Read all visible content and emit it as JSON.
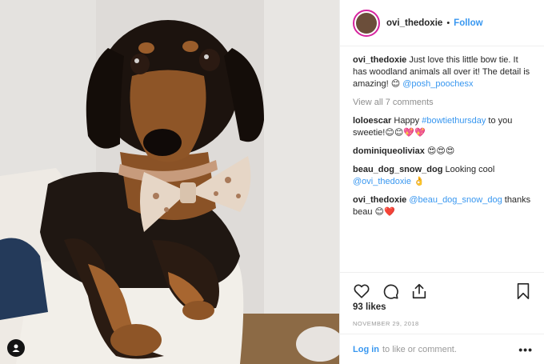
{
  "header": {
    "username": "ovi_thedoxie",
    "separator": "•",
    "follow_label": "Follow"
  },
  "caption": {
    "username": "ovi_thedoxie",
    "text": "Just love this little bow tie. It has woodland animals all over it! The detail is amazing!",
    "emoji": "😊",
    "mention": "@posh_poochesx"
  },
  "view_all_comments": "View all 7 comments",
  "comments": [
    {
      "username": "loloescar",
      "pre": "Happy ",
      "hashtag": "#bowtiethursday",
      "post": " to you sweetie!",
      "emoji": "😊😊💖💖"
    },
    {
      "username": "dominiqueoliviax",
      "pre": "",
      "hashtag": "",
      "post": "",
      "emoji": "😍😍😍"
    },
    {
      "username": "beau_dog_snow_dog",
      "pre": "Looking cool ",
      "mention": "@ovi_thedoxie",
      "emoji": "👌"
    },
    {
      "username": "ovi_thedoxie",
      "pre": "",
      "mention": "@beau_dog_snow_dog",
      "post": " thanks beau",
      "emoji": "😊❤️"
    }
  ],
  "likes": "93 likes",
  "date": "NOVEMBER 29, 2018",
  "footer": {
    "login_label": "Log in",
    "rest": "to like or comment.",
    "more_label": "•••"
  },
  "icons": {
    "like": "heart-icon",
    "comment": "comment-bubble-icon",
    "share": "share-icon",
    "save": "bookmark-icon",
    "user_tag": "user-tag-icon"
  },
  "colors": {
    "accent": "#3897f0",
    "border": "#efefef",
    "muted": "#8e8e8e"
  }
}
